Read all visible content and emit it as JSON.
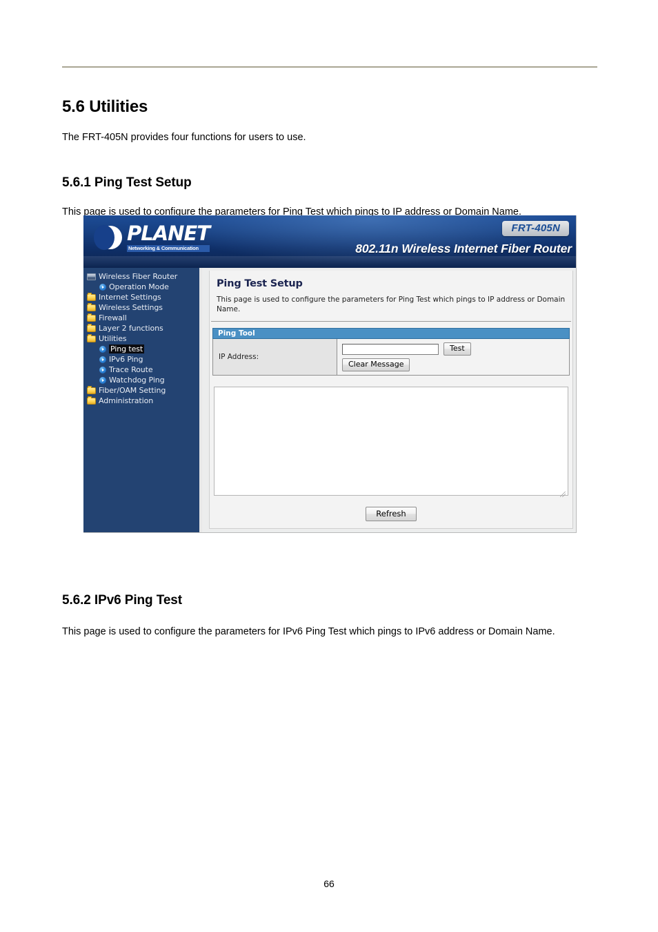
{
  "document": {
    "section_title": "5.6 Utilities",
    "section_intro": "The FRT-405N provides four functions for users to use.",
    "subsection1_title": "5.6.1 Ping Test Setup",
    "subsection1_intro": "This page is used to configure the parameters for Ping Test which pings to IP address or Domain Name.",
    "subsection2_title": "5.6.2 IPv6 Ping Test",
    "subsection2_intro": "This page is used to configure the parameters for IPv6 Ping Test which pings to IPv6 address or Domain Name.",
    "page_number": "66"
  },
  "router_ui": {
    "banner": {
      "brand": "PLANET",
      "brand_tagline": "Networking & Communication",
      "model_badge": "FRT-405N",
      "model_description": "802.11n Wireless Internet Fiber Router",
      "logo_icon": "planet-moon-logo"
    },
    "sidebar": {
      "items": [
        {
          "label": "Wireless Fiber Router",
          "icon": "router-icon",
          "level": 1,
          "selected": false
        },
        {
          "label": "Operation Mode",
          "icon": "arrow-bullet-icon",
          "level": 2,
          "selected": false
        },
        {
          "label": "Internet Settings",
          "icon": "folder-icon",
          "level": 1,
          "selected": false
        },
        {
          "label": "Wireless Settings",
          "icon": "folder-icon",
          "level": 1,
          "selected": false
        },
        {
          "label": "Firewall",
          "icon": "folder-icon",
          "level": 1,
          "selected": false
        },
        {
          "label": "Layer 2 functions",
          "icon": "folder-icon",
          "level": 1,
          "selected": false
        },
        {
          "label": "Utilities",
          "icon": "folder-open-icon",
          "level": 1,
          "selected": false
        },
        {
          "label": "Ping test",
          "icon": "arrow-bullet-icon",
          "level": 2,
          "selected": true
        },
        {
          "label": "IPv6 Ping",
          "icon": "arrow-bullet-icon",
          "level": 2,
          "selected": false
        },
        {
          "label": "Trace Route",
          "icon": "arrow-bullet-icon",
          "level": 2,
          "selected": false
        },
        {
          "label": "Watchdog Ping",
          "icon": "arrow-bullet-icon",
          "level": 2,
          "selected": false
        },
        {
          "label": "Fiber/OAM Setting",
          "icon": "folder-icon",
          "level": 1,
          "selected": false
        },
        {
          "label": "Administration",
          "icon": "folder-icon",
          "level": 1,
          "selected": false
        }
      ]
    },
    "panel": {
      "title": "Ping Test Setup",
      "description": "This page is used to configure the parameters for Ping Test which pings to IP address or Domain Name.",
      "section_bar_label": "Ping Tool",
      "ip_address_label": "IP Address:",
      "ip_address_value": "",
      "ip_address_placeholder": "",
      "test_button": "Test",
      "clear_message_button": "Clear Message",
      "result_value": "",
      "refresh_button": "Refresh"
    },
    "colors": {
      "banner_blue": "#17408a",
      "sidebar_navy": "#234372",
      "section_bar_blue": "#4a90c4",
      "panel_title_navy": "#1b2450",
      "badge_text_blue": "#1a4d96"
    }
  }
}
